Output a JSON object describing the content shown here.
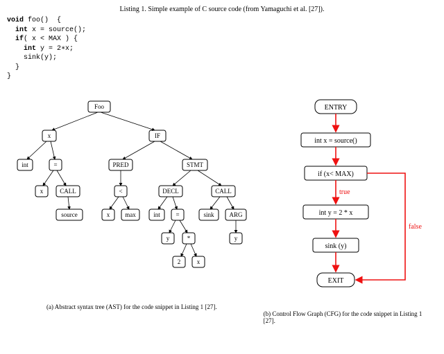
{
  "listing": {
    "caption": "Listing 1. Simple example of C source code (from Yamaguchi et al. [27]).",
    "lines": [
      {
        "kw": "void",
        "rest": " foo()  {"
      },
      {
        "kw": "  int",
        "rest": " x = source();"
      },
      {
        "kw": "  if",
        "rest": "( x < MAX ) {"
      },
      {
        "kw": "    int",
        "rest": " y = 2∗x;"
      },
      {
        "kw": "",
        "rest": "    sink(y);"
      },
      {
        "kw": "",
        "rest": "  }"
      },
      {
        "kw": "",
        "rest": "}"
      }
    ]
  },
  "ast": {
    "nodes": {
      "foo": "Foo",
      "x": "x",
      "if": "IF",
      "int1": "int",
      "eq1": "=",
      "pred": "PRED",
      "stmt": "STMT",
      "x2": "x",
      "call1": "CALL",
      "lt": "<",
      "decl": "DECL",
      "call2": "CALL",
      "source": "source",
      "x3": "x",
      "max": "max",
      "int2": "int",
      "eq2": "=",
      "sink": "sink",
      "arg": "ARG",
      "y1": "y",
      "star": "*",
      "y2": "y",
      "two": "2",
      "x4": "x"
    }
  },
  "cfg": {
    "entry": "ENTRY",
    "s1": "int x = source()",
    "s2": "if (x< MAX)",
    "s3": "int y = 2 * x",
    "s4": "sink (y)",
    "exit": "EXIT",
    "true_label": "true",
    "false_label": "false"
  },
  "subcaptions": {
    "a": "(a)  Abstract syntax tree (AST) for the code snippet in Listing 1 [27].",
    "b": "(b)  Control Flow Graph (CFG) for the code snippet in Listing 1 [27]."
  }
}
